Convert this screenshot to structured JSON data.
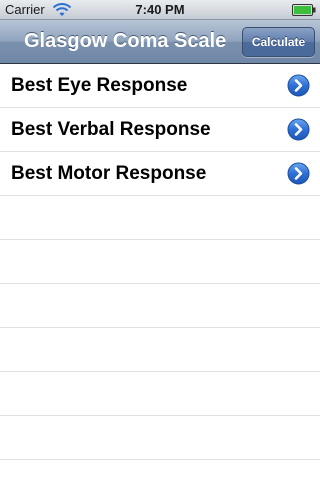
{
  "status_bar": {
    "carrier": "Carrier",
    "time": "7:40 PM",
    "wifi_icon": "wifi-icon",
    "battery_icon": "battery-icon"
  },
  "nav_bar": {
    "title": "Glasgow Coma Scale",
    "calculate_label": "Calculate"
  },
  "table": {
    "rows": [
      {
        "label": "Best Eye Response",
        "accessory_icon": "disclosure-button-icon"
      },
      {
        "label": "Best Verbal Response",
        "accessory_icon": "disclosure-button-icon"
      },
      {
        "label": "Best Motor Response",
        "accessory_icon": "disclosure-button-icon"
      }
    ]
  },
  "colors": {
    "accent": "#2f6fd6",
    "nav_bar": "#7a91ae"
  }
}
